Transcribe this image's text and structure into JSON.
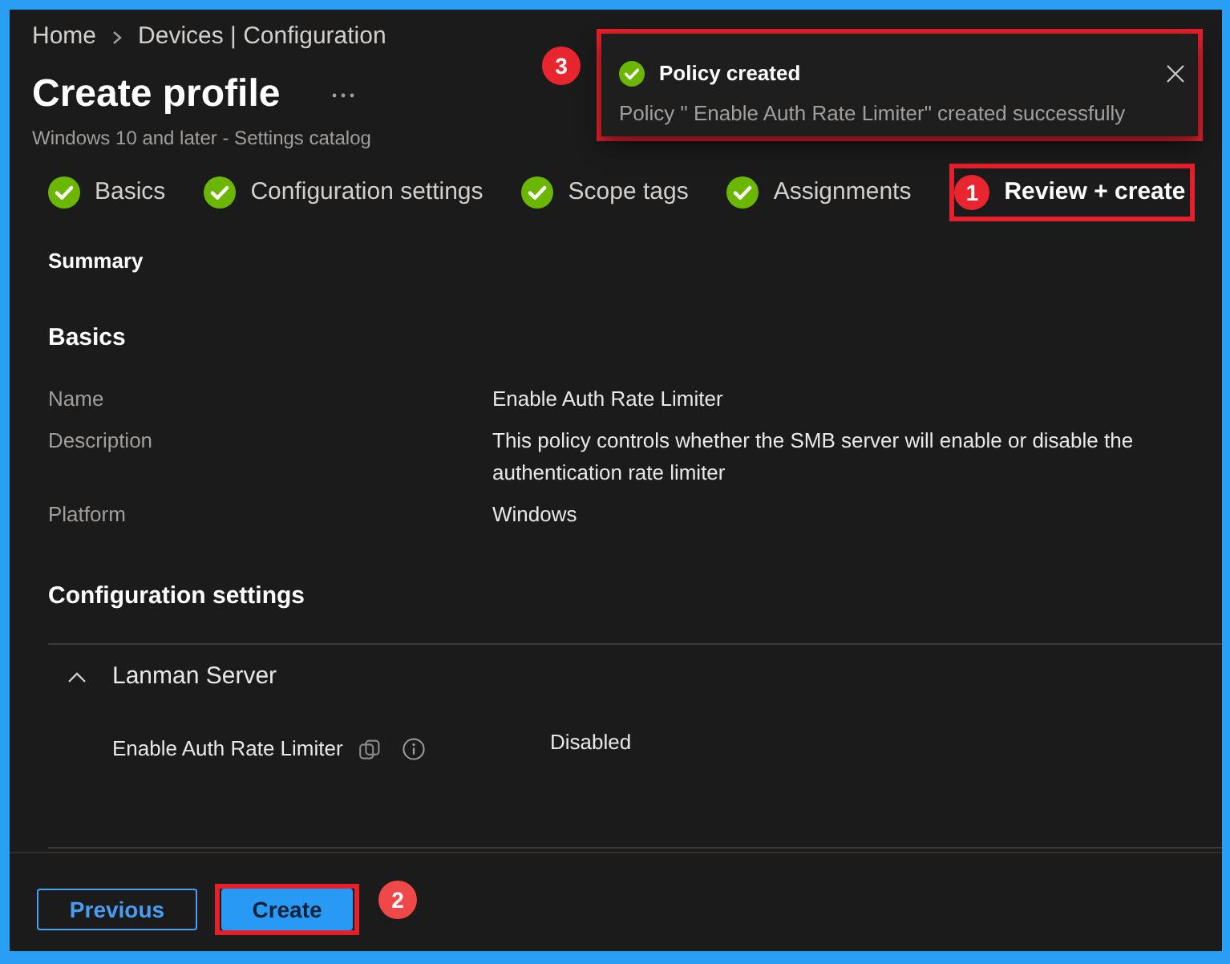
{
  "breadcrumb": [
    "Home",
    "Devices | Configuration"
  ],
  "title": "Create profile",
  "subtitle": "Windows 10 and later - Settings catalog",
  "toast": {
    "title": "Policy created",
    "message": "Policy \" Enable Auth Rate Limiter\" created successfully",
    "callout": "3",
    "highlighted": true
  },
  "tabs": [
    {
      "label": "Basics",
      "done": true,
      "selected": false
    },
    {
      "label": "Configuration settings",
      "done": true,
      "selected": false
    },
    {
      "label": "Scope tags",
      "done": true,
      "selected": false
    },
    {
      "label": "Assignments",
      "done": true,
      "selected": false
    },
    {
      "label": "Review + create",
      "done": false,
      "selected": true,
      "callout": "1",
      "highlighted": true
    }
  ],
  "summary": {
    "heading": "Summary",
    "sections": [
      {
        "heading": "Basics",
        "rows": [
          {
            "label": "Name",
            "value": "Enable Auth Rate Limiter"
          },
          {
            "label": "Description",
            "value": "This policy controls whether the SMB server will enable or disable the authentication rate limiter"
          },
          {
            "label": "Platform",
            "value": "Windows"
          }
        ]
      }
    ]
  },
  "configuration": {
    "heading": "Configuration settings",
    "groups": [
      {
        "name": "Lanman Server",
        "expanded": true,
        "settings": [
          {
            "label": "Enable Auth Rate Limiter",
            "value": "Disabled"
          }
        ]
      }
    ]
  },
  "buttons": [
    {
      "label": "Previous",
      "kind": "secondary",
      "highlighted": false
    },
    {
      "label": "Create",
      "kind": "primary",
      "highlighted": true,
      "callout": "2"
    }
  ]
}
